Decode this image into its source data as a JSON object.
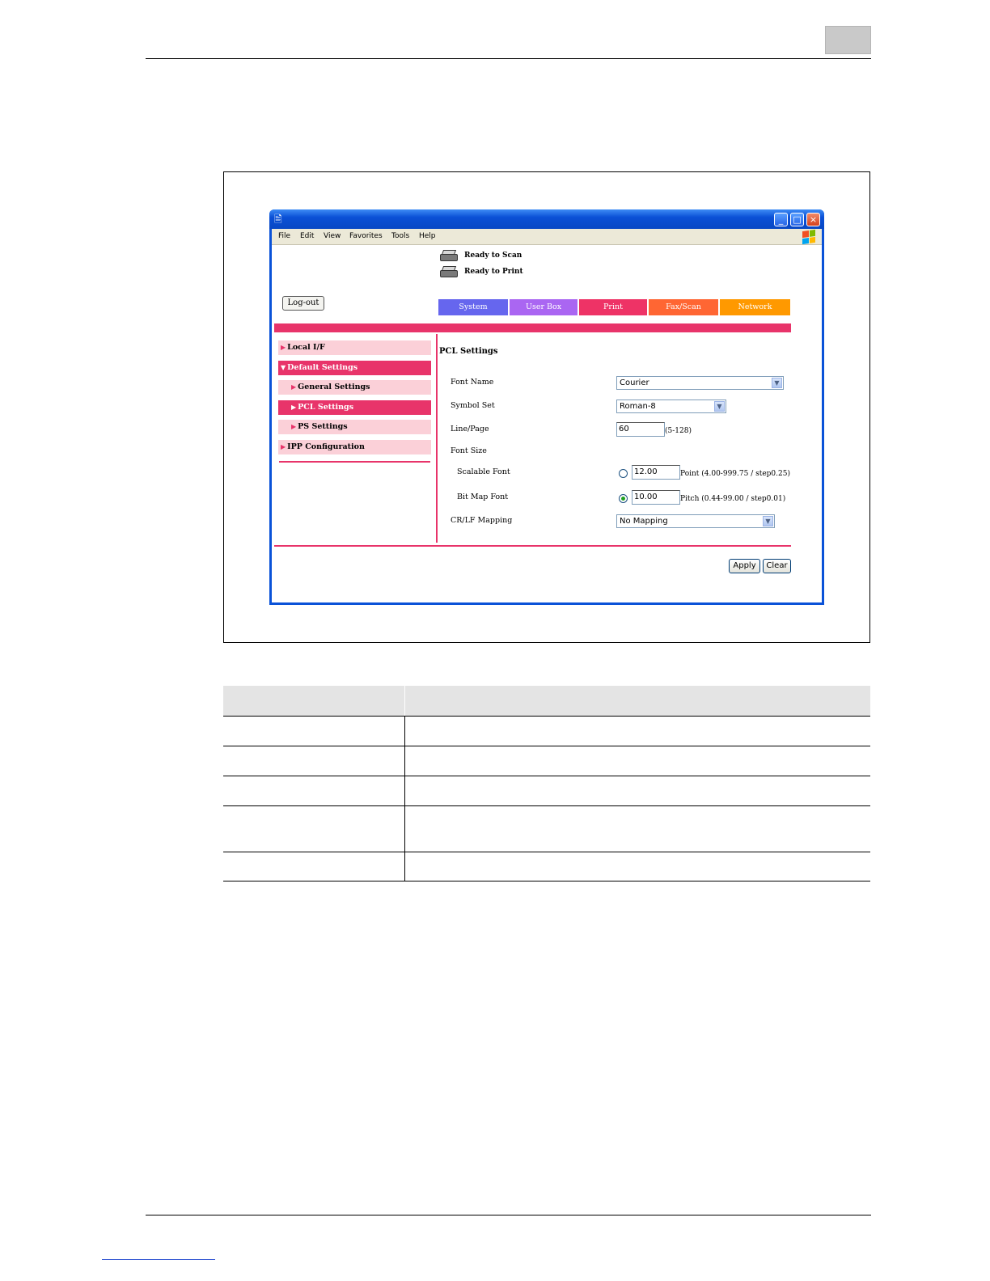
{
  "browser": {
    "menu": [
      "File",
      "Edit",
      "View",
      "Favorites",
      "Tools",
      "Help"
    ]
  },
  "status": {
    "scan": "Ready to Scan",
    "print": "Ready to Print"
  },
  "logout_label": "Log-out",
  "tabs": [
    {
      "label": "System",
      "color": "#6666ee"
    },
    {
      "label": "User Box",
      "color": "#aa66f2"
    },
    {
      "label": "Print",
      "color": "#ee3366"
    },
    {
      "label": "Fax/Scan",
      "color": "#ff6633"
    },
    {
      "label": "Network",
      "color": "#ff9900"
    }
  ],
  "sidebar": [
    {
      "label": "Local I/F",
      "arrow": "▶"
    },
    {
      "label": "Default Settings",
      "arrow": "▼"
    },
    {
      "label": "General Settings",
      "arrow": "▶"
    },
    {
      "label": "PCL Settings",
      "arrow": "▶"
    },
    {
      "label": "PS Settings",
      "arrow": "▶"
    },
    {
      "label": "IPP Configuration",
      "arrow": "▶"
    }
  ],
  "form": {
    "title": "PCL Settings",
    "font_name": {
      "label": "Font Name",
      "value": "Courier"
    },
    "symbol_set": {
      "label": "Symbol Set",
      "value": "Roman-8"
    },
    "line_page": {
      "label": "Line/Page",
      "value": "60",
      "hint": "(5-128)"
    },
    "font_size": {
      "label": "Font Size"
    },
    "scalable": {
      "label": "Scalable Font",
      "value": "12.00",
      "hint": "Point (4.00-999.75 / step0.25)",
      "selected": false
    },
    "bitmap": {
      "label": "Bit Map Font",
      "value": "10.00",
      "hint": "Pitch (0.44-99.00 / step0.01)",
      "selected": true
    },
    "crlf": {
      "label": "CR/LF Mapping",
      "value": "No Mapping"
    },
    "apply_label": "Apply",
    "clear_label": "Clear"
  },
  "colors": {
    "accent_pink": "#e8346a",
    "light_pink": "#fbd0d8",
    "xp_blue": "#0a52d8"
  }
}
